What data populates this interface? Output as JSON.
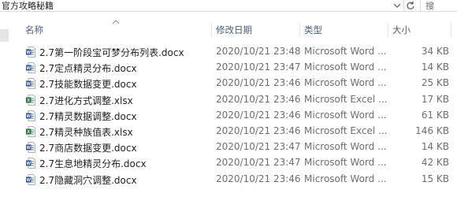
{
  "address_bar": {
    "path": "官方攻略秘籍",
    "search_placeholder": "搜"
  },
  "columns": {
    "name": "名称",
    "date": "修改日期",
    "type": "类型",
    "size": "大小"
  },
  "files": [
    {
      "name": "2.7第一阶段宝可梦分布列表.docx",
      "date": "2020/10/21 23:48",
      "type": "Microsoft Word ...",
      "size": "34 KB",
      "icon": "word-doc-icon"
    },
    {
      "name": "2.7定点精灵分布.docx",
      "date": "2020/10/21 23:47",
      "type": "Microsoft Word ...",
      "size": "14 KB",
      "icon": "word-doc-icon"
    },
    {
      "name": "2.7技能数据变更.docx",
      "date": "2020/10/21 23:46",
      "type": "Microsoft Word ...",
      "size": "25 KB",
      "icon": "word-doc-icon"
    },
    {
      "name": "2.7进化方式调整.xlsx",
      "date": "2020/10/21 23:46",
      "type": "Microsoft Excel ...",
      "size": "17 KB",
      "icon": "excel-sheet-icon"
    },
    {
      "name": "2.7精灵数据调整.docx",
      "date": "2020/10/21 23:46",
      "type": "Microsoft Word ...",
      "size": "61 KB",
      "icon": "word-doc-icon"
    },
    {
      "name": "2.7精灵种族值表.xlsx",
      "date": "2020/10/21 23:46",
      "type": "Microsoft Excel ...",
      "size": "146 KB",
      "icon": "excel-sheet-icon"
    },
    {
      "name": "2.7商店数据变更.docx",
      "date": "2020/10/21 23:47",
      "type": "Microsoft Word ...",
      "size": "14 KB",
      "icon": "word-doc-icon"
    },
    {
      "name": "2.7生息地精灵分布.docx",
      "date": "2020/10/21 23:47",
      "type": "Microsoft Word ...",
      "size": "42 KB",
      "icon": "word-doc-icon"
    },
    {
      "name": "2.7隐藏洞穴调整.docx",
      "date": "2020/10/21 23:46",
      "type": "Microsoft Word ...",
      "size": "15 KB",
      "icon": "word-doc-icon"
    }
  ],
  "colors": {
    "word": "#2b579a",
    "excel": "#217346",
    "header_text": "#4c607a"
  }
}
